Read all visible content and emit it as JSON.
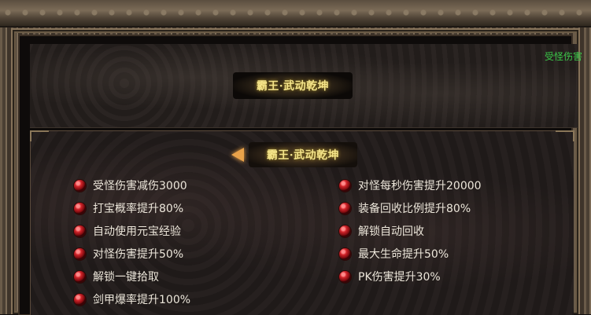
{
  "title": "霸王·武动乾坤",
  "subtitle": "霸王·武动乾坤",
  "edge_text": "受怪伤害",
  "perks_left": [
    "受怪伤害减伤3000",
    "打宝概率提升80%",
    "自动使用元宝经验",
    "对怪伤害提升50%",
    "解锁一键拾取",
    "剑甲爆率提升100%"
  ],
  "perks_right": [
    "对怪每秒伤害提升20000",
    "装备回收比例提升80%",
    "解锁自动回收",
    "最大生命提升50%",
    "PK伤害提升30%"
  ],
  "icons": {
    "perk_bullet": "red-orb-icon",
    "back_arrow": "left-arrow-icon"
  },
  "colors": {
    "title": "#f4e48a",
    "perk_text": "#ece6da",
    "orb": "#d2242a",
    "edge_text": "#3cc84a"
  }
}
